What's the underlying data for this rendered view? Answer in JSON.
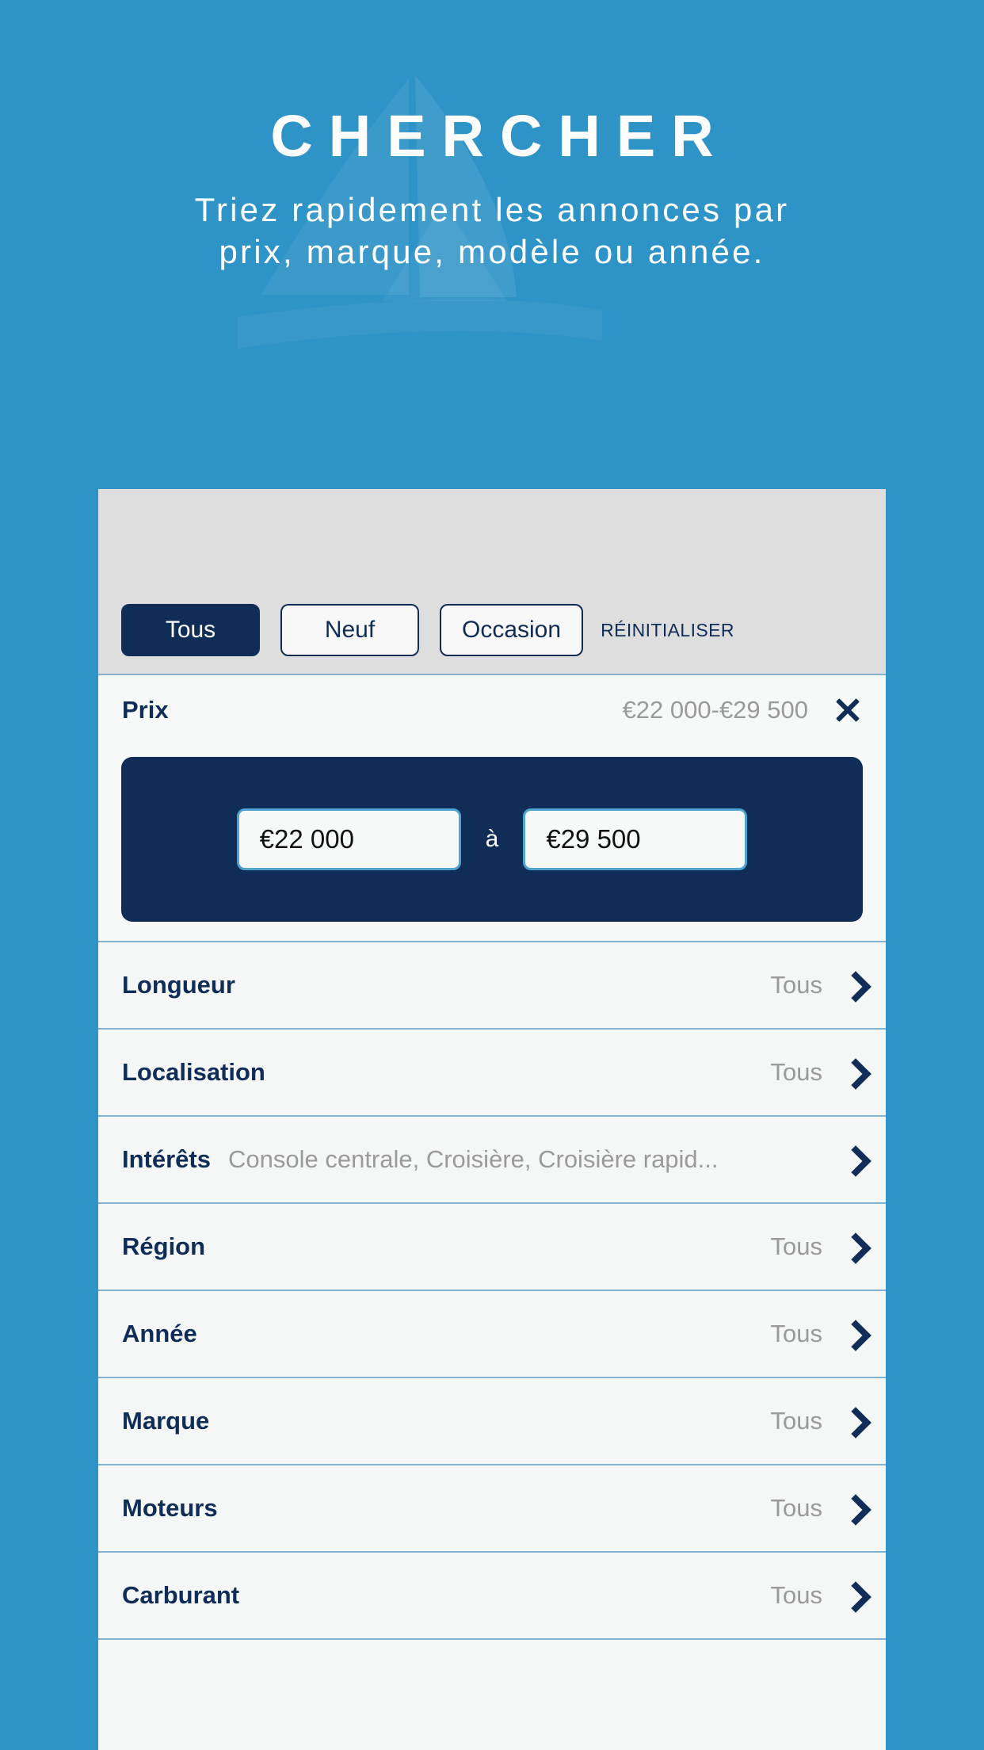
{
  "hero": {
    "title": "CHERCHER",
    "subtitle": "Triez rapidement les annonces par prix, marque, modèle ou année."
  },
  "colors": {
    "background": "#2e93c7",
    "navy": "#0f2d56",
    "card_header": "#dedede",
    "card_body": "#f5f6f6",
    "divider": "#7fb3cf",
    "muted_text": "#9a9a9a",
    "input_border": "#4fa3d0"
  },
  "segment_bar": {
    "options": [
      {
        "label": "Tous",
        "active": true
      },
      {
        "label": "Neuf",
        "active": false
      },
      {
        "label": "Occasion",
        "active": false
      }
    ],
    "reset_label": "RÉINITIALISER"
  },
  "price_filter": {
    "label": "Prix",
    "summary": "€22 000-€29 500",
    "close_icon": "close-icon",
    "min_value": "€22 000",
    "max_value": "€29 500",
    "separator": "à"
  },
  "filters": [
    {
      "label": "Longueur",
      "value": "Tous",
      "wide": false
    },
    {
      "label": "Localisation",
      "value": "Tous",
      "wide": false
    },
    {
      "label": "Intérêts",
      "value": "Console centrale, Croisière, Croisière rapid...",
      "wide": true
    },
    {
      "label": "Région",
      "value": "Tous",
      "wide": false
    },
    {
      "label": "Année",
      "value": "Tous",
      "wide": false
    },
    {
      "label": "Marque",
      "value": "Tous",
      "wide": false
    },
    {
      "label": "Moteurs",
      "value": "Tous",
      "wide": false
    },
    {
      "label": "Carburant",
      "value": "Tous",
      "wide": false
    },
    {
      "label": "",
      "value": "",
      "wide": false
    }
  ]
}
